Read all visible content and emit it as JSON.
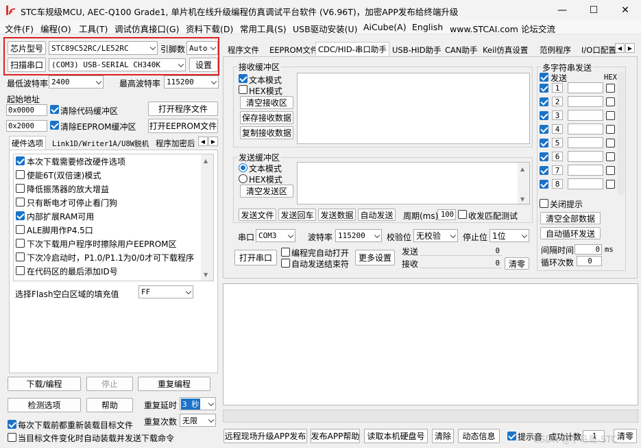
{
  "window": {
    "title": "STC车规级MCU, AEC-Q100 Grade1, 单片机在线升级编程仿真调试平台软件 (V6.96T)，加密APP发布给终端升级",
    "minimize": "—",
    "maximize": "☐",
    "close": "✕"
  },
  "menu": [
    "文件(F)",
    "编程(O)",
    "工具(T)",
    "调试仿真接口(G)",
    "资料下载(D)",
    "常用工具(S)",
    "USB驱动安装(U)",
    "AiCube(A)",
    "English",
    "www.STCAI.com 论坛交流"
  ],
  "chip": {
    "label": "芯片型号",
    "value": "STC89C52RC/LE52RC",
    "pins_label": "引脚数",
    "pins_value": "Auto",
    "scan_label": "扫描串口",
    "port_value": "(COM3) USB-SERIAL CH340K",
    "settings_label": "设置"
  },
  "baud": {
    "min_label": "最低波特率",
    "min_value": "2400",
    "max_label": "最高波特率",
    "max_value": "115200"
  },
  "address": {
    "label": "起始地址",
    "code_addr": "0x0000",
    "clear_code": "清除代码缓冲区",
    "open_program": "打开程序文件",
    "eeprom_addr": "0x2000",
    "clear_eeprom": "清除EEPROM缓冲区",
    "open_eeprom": "打开EEPROM文件"
  },
  "left_tabs": [
    "硬件选项",
    "Link1D/Writer1A/U8W脱机",
    "程序加密后"
  ],
  "hw_options": [
    {
      "label": "本次下载需要修改硬件选项",
      "checked": true
    },
    {
      "label": "使能6T(双倍速)模式",
      "checked": false
    },
    {
      "label": "降低振荡器的放大增益",
      "checked": false
    },
    {
      "label": "只有断电才可停止看门狗",
      "checked": false
    },
    {
      "label": "内部扩展RAM可用",
      "checked": true
    },
    {
      "label": "ALE脚用作P4.5口",
      "checked": false
    },
    {
      "label": "下次下载用户程序时擦除用户EEPROM区",
      "checked": false
    },
    {
      "label": "下次冷启动时，P1.0/P1.1为0/0才可下载程序",
      "checked": false
    },
    {
      "label": "在代码区的最后添加ID号",
      "checked": false
    }
  ],
  "fill": {
    "label": "选择Flash空白区域的填充值",
    "value": "FF"
  },
  "bottom_left": {
    "download": "下载/编程",
    "stop": "停止",
    "reprogram": "重复编程",
    "check": "检测选项",
    "help": "帮助",
    "delay_label": "重复延时",
    "delay_value": "3 秒",
    "count_label": "重复次数",
    "count_value": "无限",
    "reload_label": "每次下载前都重新装载目标文件",
    "auto_label": "当目标文件变化时自动装载并发送下载命令"
  },
  "right_tabs": [
    "程序文件",
    "EEPROM文件",
    "CDC/HID-串口助手",
    "USB-HID助手",
    "CAN助手",
    "Keil仿真设置",
    "范例程序",
    "I/O口配置"
  ],
  "receive": {
    "title": "接收缓冲区",
    "text_mode": "文本模式",
    "hex_mode": "HEX模式",
    "clear": "清空接收区",
    "save": "保存接收数据",
    "copy": "复制接收数据"
  },
  "send": {
    "title": "发送缓冲区",
    "text_mode": "文本模式",
    "hex_mode": "HEX模式",
    "clear": "清空发送区",
    "send_file": "发送文件",
    "send_enter": "发送回车",
    "send_data": "发送数据",
    "auto_send": "自动发送",
    "period_label": "周期(ms)",
    "period_value": "100",
    "match_label": "收发匹配测试"
  },
  "multi": {
    "title": "多字符串发送",
    "send_label": "发送",
    "hex_label": "HEX",
    "rows": [
      "1",
      "2",
      "3",
      "4",
      "5",
      "6",
      "7",
      "8"
    ],
    "close_tip": "关闭提示",
    "clear_all": "清空全部数据",
    "auto_loop": "自动循环发送",
    "interval_label": "间隔时间",
    "interval_value": "0",
    "interval_unit": "ms",
    "loop_label": "循环次数",
    "loop_value": "0"
  },
  "serial": {
    "port_label": "串口",
    "port_value": "COM3",
    "baud_label": "波特率",
    "baud_value": "115200",
    "parity_label": "校验位",
    "parity_value": "无校验",
    "stop_label": "停止位",
    "stop_value": "1位",
    "open": "打开串口",
    "auto_open": "编程完自动打开",
    "auto_close": "自动发送结束符",
    "more": "更多设置",
    "tx_label": "发送",
    "tx_value": "0",
    "rx_label": "接收",
    "rx_value": "0",
    "clear_count": "清零"
  },
  "footer": {
    "remote": "远程现场升级APP发布",
    "publish_help": "发布APP帮助",
    "read_disk": "读取本机硬盘号",
    "clear": "清除",
    "anim": "动态信息",
    "tip_label": "提示音",
    "success_label": "成功计数",
    "success_value": "1",
    "reset": "清零",
    "watermark": "CSDN @小马哥-STC"
  }
}
